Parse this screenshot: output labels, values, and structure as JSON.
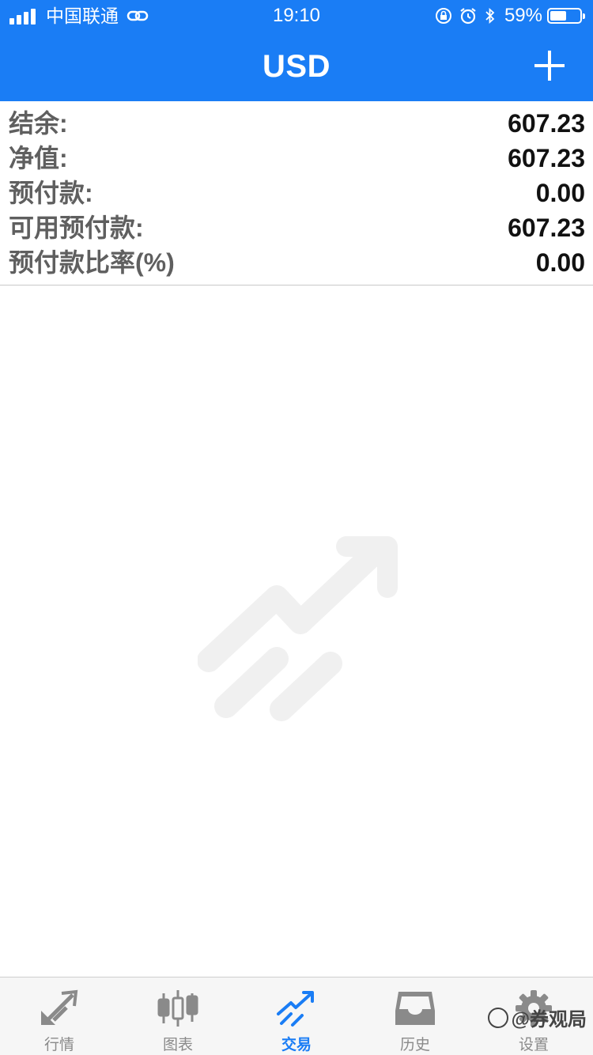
{
  "status_bar": {
    "carrier": "中国联通",
    "time": "19:10",
    "battery_percent": "59%",
    "battery_level": 0.59
  },
  "header": {
    "title": "USD",
    "add_icon": "plus-icon"
  },
  "summary": {
    "rows": [
      {
        "label": "结余:",
        "value": "607.23"
      },
      {
        "label": "净值:",
        "value": "607.23"
      },
      {
        "label": "预付款:",
        "value": "0.00"
      },
      {
        "label": "可用预付款:",
        "value": "607.23"
      },
      {
        "label": "预付款比率(%)",
        "value": "0.00"
      }
    ]
  },
  "empty_state": {
    "icon": "trade-trend-icon"
  },
  "tabs": [
    {
      "label": "行情",
      "icon": "quotes-arrows-icon",
      "active": false
    },
    {
      "label": "图表",
      "icon": "candlestick-icon",
      "active": false
    },
    {
      "label": "交易",
      "icon": "trade-trend-icon",
      "active": true
    },
    {
      "label": "历史",
      "icon": "inbox-tray-icon",
      "active": false
    },
    {
      "label": "设置",
      "icon": "gear-icon",
      "active": false
    }
  ],
  "watermark_text": "@券观局",
  "colors": {
    "accent": "#1a7df5",
    "tab_inactive": "#8a8a8a",
    "label_text": "#5f5f5f"
  }
}
